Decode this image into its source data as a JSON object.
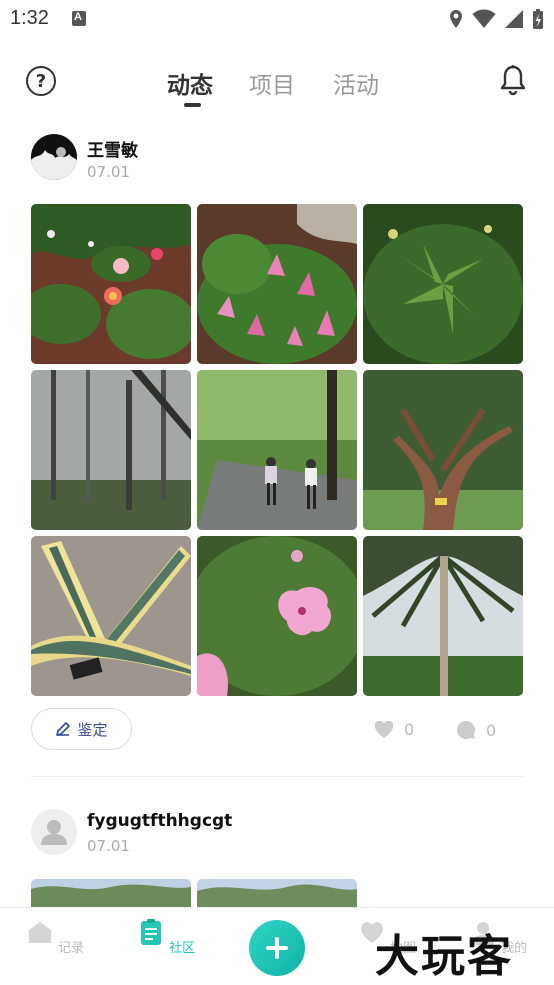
{
  "status_bar": {
    "time": "1:32"
  },
  "header": {
    "tabs": [
      {
        "label": "动态",
        "active": true
      },
      {
        "label": "项目",
        "active": false
      },
      {
        "label": "活动",
        "active": false
      }
    ],
    "help_icon": "help-circle-icon",
    "bell_icon": "bell-icon"
  },
  "posts": [
    {
      "author": "王雪敏",
      "date": "07.01",
      "photos": [
        "pink-flowers",
        "pink-spirea",
        "green-shrub",
        "misty-forest",
        "hikers-on-road",
        "twisted-tree-trunk",
        "agave-plant",
        "pink-hibiscus",
        "tall-pine-tree"
      ],
      "identify_label": "鉴定",
      "likes": "0",
      "comments": "0"
    },
    {
      "author": "fygugtfthhgcgt",
      "date": "07.01"
    }
  ],
  "bottom_nav": {
    "items": [
      {
        "label": "记录",
        "icon": "home-icon",
        "active": false
      },
      {
        "label": "社区",
        "icon": "clipboard-icon",
        "active": true
      },
      {
        "label": "地图",
        "icon": "map-heart-icon",
        "active": false
      },
      {
        "label": "我的",
        "icon": "profile-icon",
        "active": false
      }
    ],
    "fab_icon": "plus-icon"
  },
  "watermark": "大玩客",
  "colors": {
    "accent": "#22c7b5",
    "identify_text": "#3a4a9a"
  }
}
